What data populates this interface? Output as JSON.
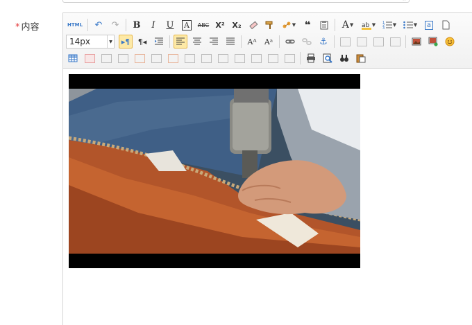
{
  "label": {
    "required_mark": "*",
    "text": "内容"
  },
  "toolbar": {
    "html_label": "HTML",
    "bold": "B",
    "italic": "I",
    "underline": "U",
    "font_border": "A",
    "strike": "ABC",
    "superscript": "X²",
    "subscript": "X₂",
    "quote": "❝",
    "font_color": "A",
    "font_size": "14px",
    "insert_image_alt": "a"
  },
  "colors": {
    "accent": "#3a79c8",
    "active_bg": "#fde9a6",
    "required": "#e4393c"
  },
  "video": {
    "scene": "hands-stapling-sofa-upholstery"
  }
}
